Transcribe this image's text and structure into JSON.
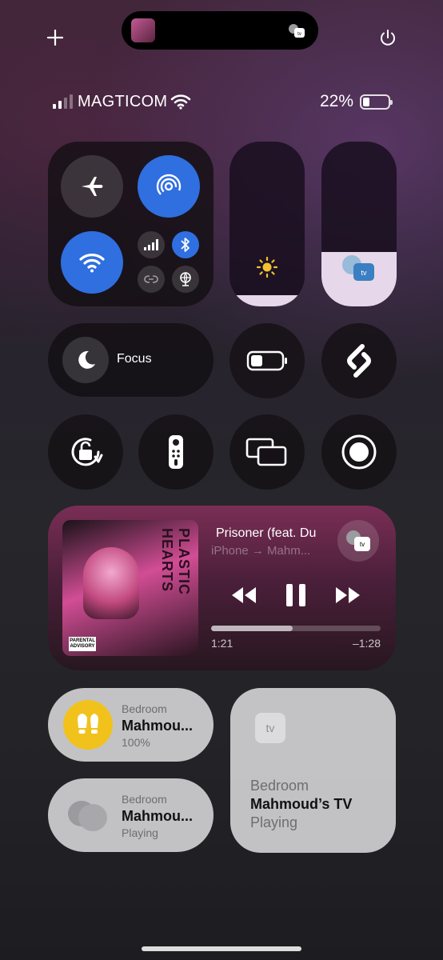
{
  "top_bar": {
    "add_icon": "plus-icon",
    "power_icon": "power-icon",
    "island": {
      "device_badge": "tv"
    }
  },
  "status": {
    "carrier": "MAGTICOM",
    "battery_percent": "22%",
    "battery_level": 0.22
  },
  "connectivity": {
    "airplane_mode": false,
    "airdrop": true,
    "wifi": true,
    "cellular": true,
    "bluetooth": true
  },
  "sliders": {
    "brightness_level": 0.07,
    "volume_level": 0.33,
    "volume_badge": "tv"
  },
  "focus": {
    "label": "Focus"
  },
  "now_playing": {
    "title": "Prisoner (feat. Du",
    "route": "iPhone → Mahm...",
    "elapsed": "1:21",
    "remaining": "–1:28",
    "progress": 0.48,
    "device_badge": "tv",
    "album_text": "PLASTIC HEARTS"
  },
  "home": {
    "tile1": {
      "room": "Bedroom",
      "name": "Mahmou...",
      "status": "100%"
    },
    "tile2": {
      "room": "Bedroom",
      "name": "Mahmou...",
      "status": "Playing"
    },
    "tile3": {
      "badge": "tv",
      "room": "Bedroom",
      "name": "Mahmoud’s TV",
      "status": "Playing"
    }
  }
}
